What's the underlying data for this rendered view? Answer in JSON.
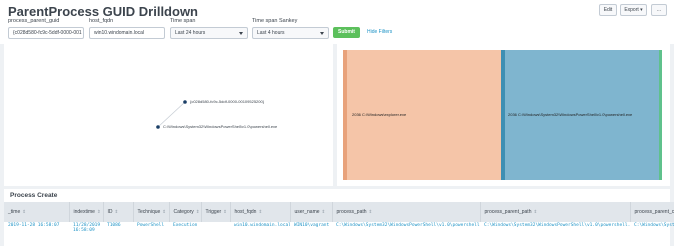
{
  "header": {
    "title": "ParentProcess GUID Drilldown",
    "edit_label": "Edit",
    "export_label": "Export",
    "more_label": "..."
  },
  "filters": {
    "guid_label": "process_parent_guid",
    "guid_value": "{c028d580-fc9c-5ddf-0000-001",
    "host_label": "host_fqdn",
    "host_value": "win10.windomain.local",
    "timespan_label": "Time span",
    "timespan_value": "Last 24 hours",
    "sankey_label": "Time span Sankey",
    "sankey_value": "Last 4 hours",
    "submit_label": "Submit",
    "hide_label": "Hide Filters"
  },
  "graph": {
    "nodes": [
      {
        "label": "{c028d580-fc9c-5ddf-0000-00109525200}"
      },
      {
        "label": "C:\\Windows\\System32\\WindowsPowerShell\\v1.0\\powershell.exe"
      }
    ],
    "colors": {
      "node": "#1a3e66",
      "edge": "#c9cfd6"
    }
  },
  "sankey": {
    "source_label": "2036 C:\\Windows\\explorer.exe",
    "target_label": "2036 C:\\Windows\\System32\\WindowsPowerShell\\v1.0\\powershell.exe",
    "colors": {
      "source": "#e8a27b",
      "flow": "#f5c5a8",
      "target": "#7fb5cf",
      "target_dark": "#3f8fb3",
      "edge": "#5fc18c"
    }
  },
  "table": {
    "title": "Process Create",
    "columns": [
      "_time",
      "indextime",
      "ID",
      "Technique",
      "Category",
      "Trigger",
      "host_fqdn",
      "user_name",
      "process_path",
      "process_parent_path",
      "process_parent_comm"
    ],
    "rows": [
      [
        "2019-11-28 16:58:07",
        "11/28/2019 16:58:09",
        "T1086",
        "PowerShell",
        "Execution",
        "",
        "win10.windomain.local",
        "WIN10\\vagrant",
        "C:\\Windows\\System32\\WindowsPowerShell\\v1.0\\powershell.exe",
        "C:\\Windows\\System32\\WindowsPowerShell\\v1.0\\powershell.exe",
        "C:\\Windows\\System32\\Win"
      ]
    ]
  }
}
